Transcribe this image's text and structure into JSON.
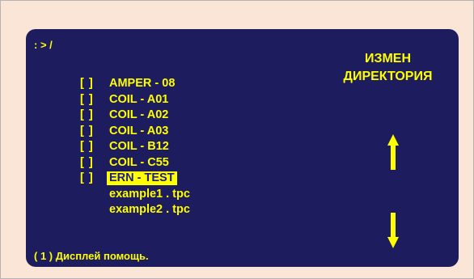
{
  "path": ": > /",
  "panel": {
    "line1": "ИЗМЕН",
    "line2": "ДИРЕКТОРИЯ"
  },
  "checkbox_label": "[ ]",
  "folders": [
    {
      "name": "AMPER - 08",
      "selected": false
    },
    {
      "name": "COIL - A01",
      "selected": false
    },
    {
      "name": "COIL - A02",
      "selected": false
    },
    {
      "name": "COIL - A03",
      "selected": false
    },
    {
      "name": "COIL - B12",
      "selected": false
    },
    {
      "name": "COIL - C55",
      "selected": false
    },
    {
      "name": "ERN - TEST",
      "selected": true
    }
  ],
  "files": [
    {
      "name": "example1 . tpc"
    },
    {
      "name": "example2 . tpc"
    }
  ],
  "help": "( 1 ) Дисплей помощь.",
  "icons": {
    "up": "arrow-up-icon",
    "down": "arrow-down-icon"
  },
  "colors": {
    "background": "#fbe5d6",
    "screen": "#1c1c5e",
    "text": "#ffff00",
    "selected_text": "#1c1c9a"
  }
}
